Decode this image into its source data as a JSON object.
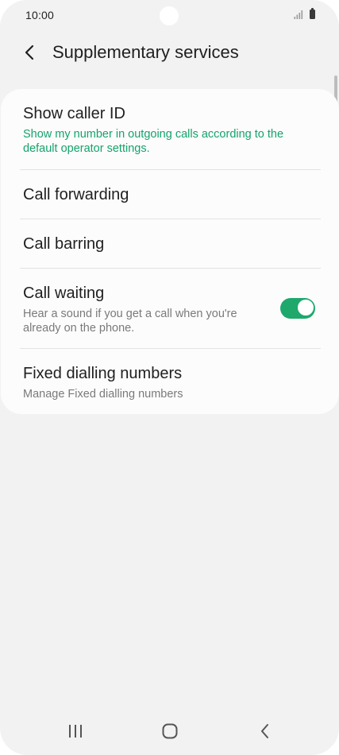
{
  "status_bar": {
    "time": "10:00"
  },
  "header": {
    "title": "Supplementary services",
    "back_icon": "chevron-left-icon"
  },
  "settings": {
    "show_caller_id": {
      "title": "Show caller ID",
      "summary": "Show my number in outgoing calls according to the default operator settings."
    },
    "call_forwarding": {
      "title": "Call forwarding"
    },
    "call_barring": {
      "title": "Call barring"
    },
    "call_waiting": {
      "title": "Call waiting",
      "summary": "Hear a sound if you get a call when you're already on the phone.",
      "enabled": true
    },
    "fixed_dialling": {
      "title": "Fixed dialling numbers",
      "summary": "Manage Fixed dialling numbers"
    }
  },
  "nav_bar": {
    "recents_icon": "recent-apps-icon",
    "home_icon": "home-icon",
    "back_icon": "back-icon"
  },
  "colors": {
    "accent": "#14a36b",
    "toggle_on": "#1fa86c",
    "background": "#f2f2f2",
    "card": "#fcfcfc"
  }
}
